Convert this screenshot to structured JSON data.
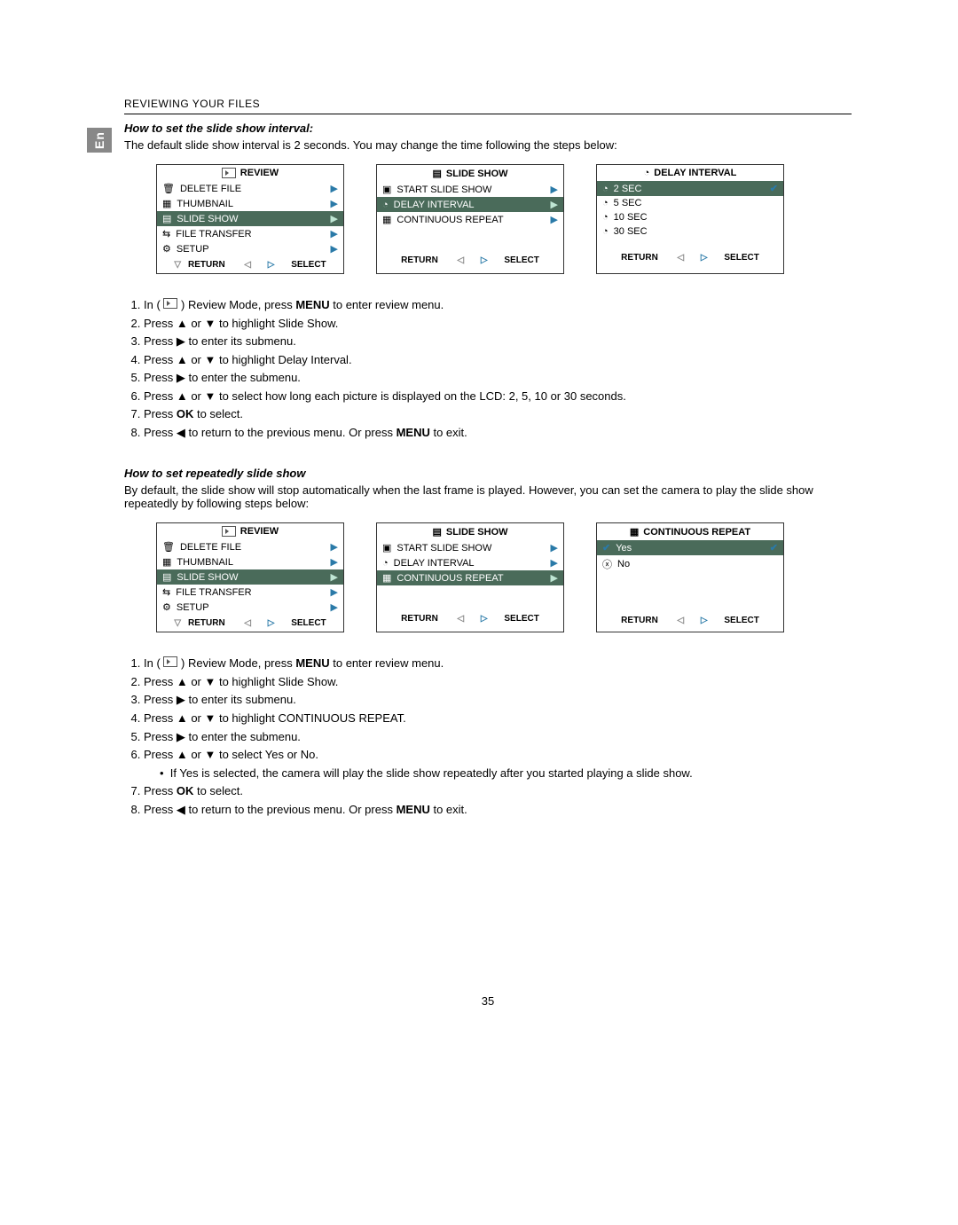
{
  "header": {
    "section": "REVIEWING YOUR FILES"
  },
  "en_tab": "En",
  "interval": {
    "title": "How to set the slide show interval:",
    "intro": "The default slide show interval is 2 seconds. You may change the time following the steps below:",
    "screens": {
      "review": {
        "title": "REVIEW",
        "items": [
          "DELETE FILE",
          "THUMBNAIL",
          "SLIDE SHOW",
          "FILE TRANSFER",
          "SETUP"
        ],
        "hi": "SLIDE SHOW",
        "footL": "RETURN",
        "footR": "SELECT"
      },
      "slideshow": {
        "title": "SLIDE SHOW",
        "items": [
          "START SLIDE SHOW",
          "DELAY INTERVAL",
          "CONTINUOUS REPEAT"
        ],
        "hi": "DELAY INTERVAL",
        "footL": "RETURN",
        "footR": "SELECT"
      },
      "delay": {
        "title": "DELAY INTERVAL",
        "items": [
          "2   SEC",
          "5   SEC",
          "10 SEC",
          "30 SEC"
        ],
        "hi": "2   SEC",
        "footL": "RETURN",
        "footR": "SELECT"
      }
    },
    "steps": {
      "s1a": "In ( ",
      "s1b": " ) Review Mode, press ",
      "s1c": "MENU",
      "s1d": " to enter review menu.",
      "s2": "Press ▲ or ▼ to highlight Slide Show.",
      "s3": "Press ▶ to enter its submenu.",
      "s4": "Press ▲ or ▼ to highlight Delay Interval.",
      "s5": "Press ▶ to enter the submenu.",
      "s6": "Press ▲ or ▼ to select how long each picture is displayed on the LCD: 2, 5, 10 or 30 seconds.",
      "s7a": "Press ",
      "s7b": "OK",
      "s7c": " to select.",
      "s8a": "Press ◀ to return to the previous menu. Or press ",
      "s8b": "MENU",
      "s8c": " to exit."
    }
  },
  "repeat": {
    "title": "How to set repeatedly slide show",
    "intro": "By default, the slide show will stop automatically when the last frame is played. However, you can set the camera to play the slide show repeatedly by following steps below:",
    "screens": {
      "review": {
        "title": "REVIEW",
        "items": [
          "DELETE FILE",
          "THUMBNAIL",
          "SLIDE SHOW",
          "FILE TRANSFER",
          "SETUP"
        ],
        "hi": "SLIDE SHOW",
        "footL": "RETURN",
        "footR": "SELECT"
      },
      "slideshow": {
        "title": "SLIDE SHOW",
        "items": [
          "START SLIDE SHOW",
          "DELAY INTERVAL",
          "CONTINUOUS REPEAT"
        ],
        "hi": "CONTINUOUS REPEAT",
        "footL": "RETURN",
        "footR": "SELECT"
      },
      "cont": {
        "title": "CONTINUOUS REPEAT",
        "items": [
          "Yes",
          "No"
        ],
        "hi": "Yes",
        "footL": "RETURN",
        "footR": "SELECT"
      }
    },
    "steps": {
      "s1a": "In ( ",
      "s1b": " ) Review Mode, press ",
      "s1c": "MENU",
      "s1d": " to enter review menu.",
      "s2": "Press ▲ or ▼ to highlight Slide Show.",
      "s3": "Press ▶ to enter its submenu.",
      "s4": "Press ▲ or ▼ to highlight CONTINUOUS REPEAT.",
      "s5": "Press ▶ to enter the submenu.",
      "s6": "Press ▲ or ▼ to select Yes or No.",
      "s6b": "If Yes is selected, the camera will play the slide show repeatedly after you started playing a slide show.",
      "s7a": "Press ",
      "s7b": "OK",
      "s7c": " to select.",
      "s8a": "Press ◀ to return to the previous menu. Or press ",
      "s8b": "MENU",
      "s8c": " to exit."
    }
  },
  "page_number": "35",
  "glyphs": {
    "play_icon": "▶",
    "left": "◀",
    "right": "▶",
    "up": "▲",
    "down": "▼",
    "check": "✔",
    "x": "ⓧ",
    "clock": "◔",
    "grid": "▦",
    "slides": "▤",
    "trash": "🗑",
    "transfer": "⇆",
    "setup": "⚙",
    "play_box": "▣",
    "tri_d": "▽",
    "tri_l": "◁",
    "tri_r": "▷"
  }
}
